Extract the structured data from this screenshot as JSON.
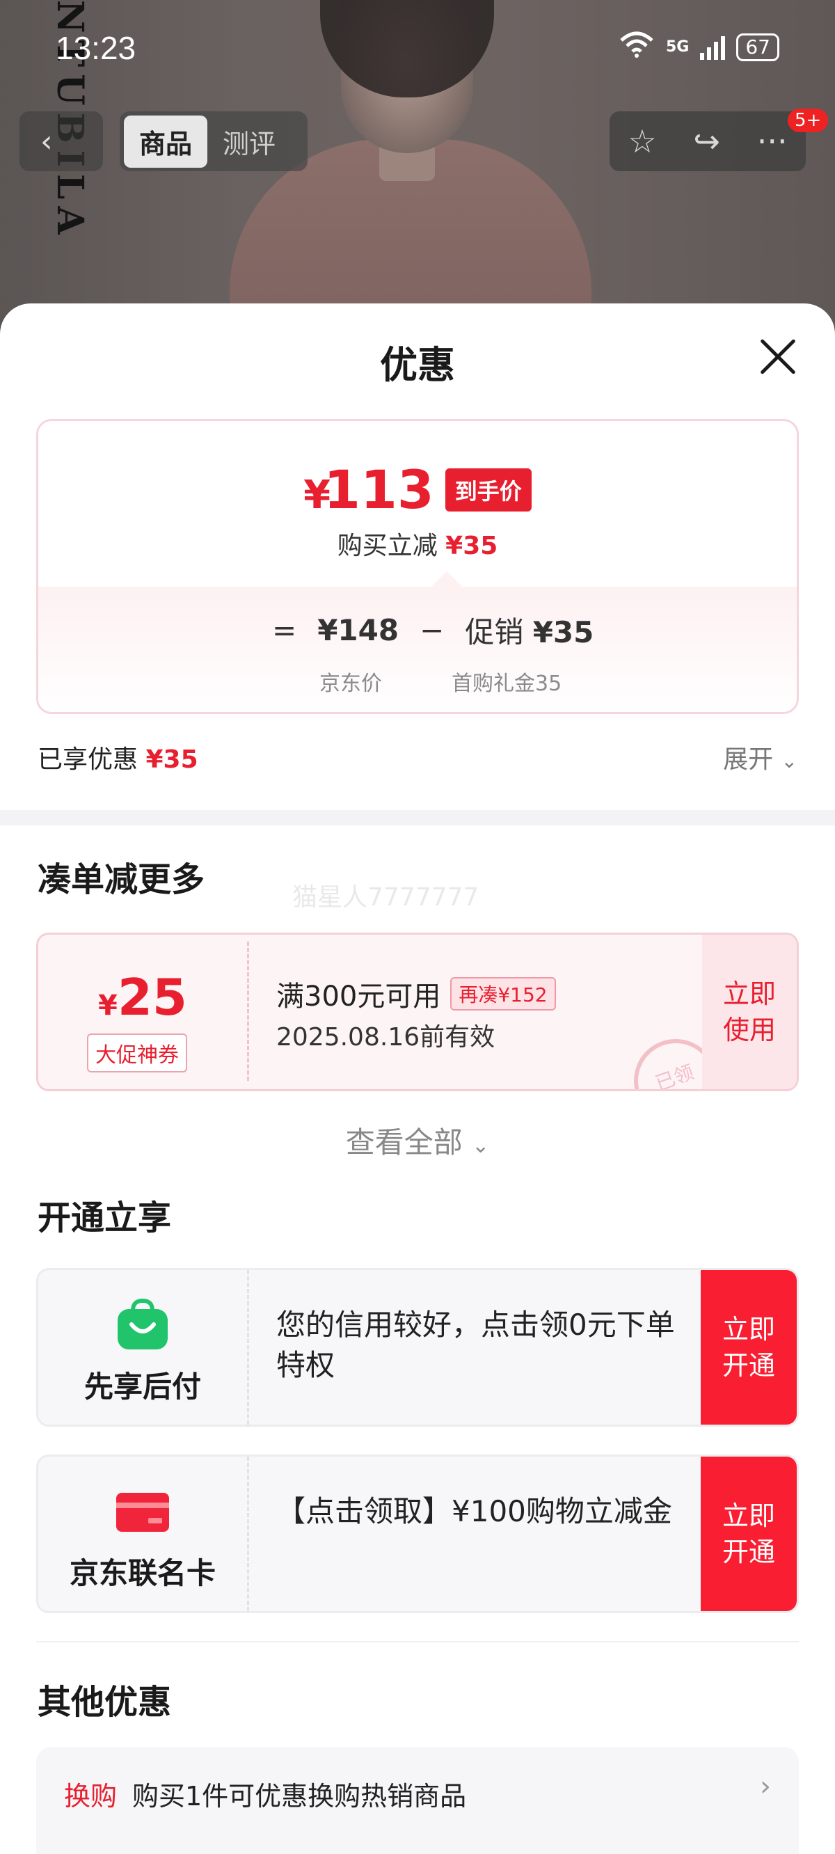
{
  "status_bar": {
    "time": "13:23",
    "network": "5G",
    "battery": "67"
  },
  "background": {
    "brand_text": "NTUBILA"
  },
  "top_nav": {
    "tab_active": "商品",
    "tab_inactive": "测评",
    "more_badge": "5+"
  },
  "sheet": {
    "title": "优惠",
    "price_card": {
      "currency": "¥",
      "final_price": "113",
      "final_tag": "到手价",
      "reduce_label": "购买立减",
      "reduce_amount": "¥35",
      "equals": "=",
      "jd_price": "¥148",
      "minus": "−",
      "promo_label": "促销",
      "promo_amount": "¥35",
      "jd_price_label": "京东价",
      "promo_detail": "首购礼金35"
    },
    "enjoyed": {
      "label": "已享优惠",
      "amount": "¥35",
      "expand": "展开"
    },
    "more_section": {
      "heading": "凑单减更多",
      "watermark": "猫星人7777777",
      "coupon": {
        "currency": "¥",
        "amount": "25",
        "tag": "大促神券",
        "condition": "满300元可用",
        "extra": "再凑¥152",
        "expiry": "2025.08.16前有效",
        "stamp": "已领",
        "button": "立即使用"
      },
      "view_all": "查看全部"
    },
    "open_section": {
      "heading": "开通立享",
      "cards": [
        {
          "label": "先享后付",
          "icon": "shopping-bag-icon",
          "text": "您的信用较好，点击领0元下单特权",
          "button": "立即开通"
        },
        {
          "label": "京东联名卡",
          "icon": "credit-card-icon",
          "text": "【点击领取】¥100购物立减金",
          "button": "立即开通"
        }
      ]
    },
    "other_section": {
      "heading": "其他优惠",
      "items": [
        {
          "tag": "换购",
          "text": "购买1件可优惠换购热销商品"
        }
      ]
    }
  },
  "colors": {
    "accent": "#e81f2f",
    "button_red": "#fa1e32",
    "green_icon": "#21c46b"
  }
}
